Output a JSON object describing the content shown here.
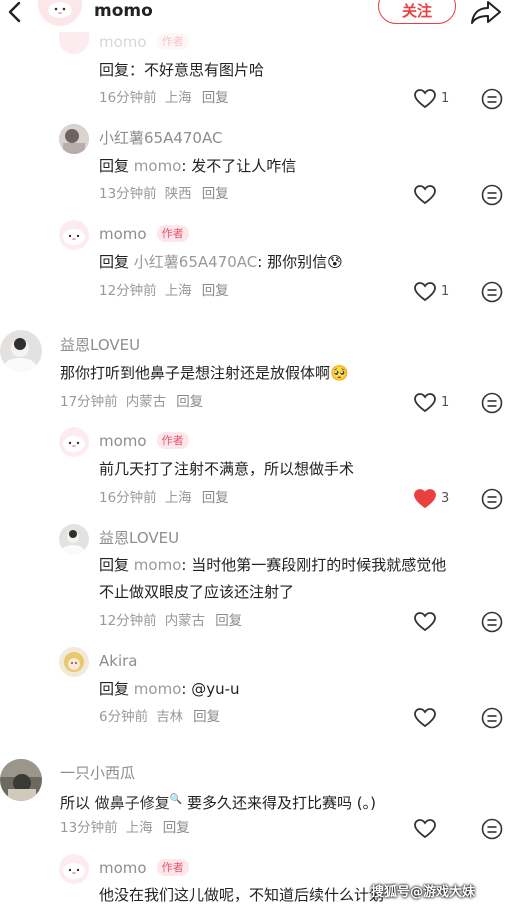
{
  "header": {
    "title": "momo",
    "follow_label": "关注"
  },
  "comments": [
    {
      "user": "momo",
      "author_tag": "作者",
      "prefix": "回复",
      "target": "",
      "text": "：不好意思有图片哈",
      "time": "16分钟前",
      "location": "上海",
      "reply": "回复",
      "likes": "1",
      "liked": false
    },
    {
      "user": "小红薯65A470AC",
      "author_tag": "",
      "prefix": "回复",
      "target": "momo",
      "text": ": 发不了让人咋信",
      "time": "13分钟前",
      "location": "陕西",
      "reply": "回复",
      "likes": "",
      "liked": false
    },
    {
      "user": "momo",
      "author_tag": "作者",
      "prefix": "回复",
      "target": "小红薯65A470AC",
      "text": ": 那你别信",
      "emoji": "😰",
      "time": "12分钟前",
      "location": "上海",
      "reply": "回复",
      "likes": "1",
      "liked": false
    },
    {
      "user": "益恩LOVEU",
      "author_tag": "",
      "text": "那你打听到他鼻子是想注射还是放假体啊",
      "emoji": "🥺",
      "time": "17分钟前",
      "location": "内蒙古",
      "reply": "回复",
      "likes": "1",
      "liked": false
    },
    {
      "user": "momo",
      "author_tag": "作者",
      "text": "前几天打了注射不满意，所以想做手术",
      "time": "16分钟前",
      "location": "上海",
      "reply": "回复",
      "likes": "3",
      "liked": true
    },
    {
      "user": "益恩LOVEU",
      "author_tag": "",
      "prefix": "回复",
      "target": "momo",
      "text": ": 当时他第一赛段刚打的时候我就感觉他",
      "text_line2": "不止做双眼皮了应该还注射了",
      "time": "12分钟前",
      "location": "内蒙古",
      "reply": "回复",
      "likes": "",
      "liked": false
    },
    {
      "user": "Akira",
      "author_tag": "",
      "prefix": "回复",
      "target": "momo",
      "text": ": @yu-u",
      "time": "6分钟前",
      "location": "吉林",
      "reply": "回复",
      "likes": "",
      "liked": false
    },
    {
      "user": "一只小西瓜",
      "author_tag": "",
      "text_a": "所以 ",
      "highlight": "做鼻子修复",
      "text_b": " 要多久还来得及打比赛吗 (。)",
      "time": "13分钟前",
      "location": "上海",
      "reply": "回复",
      "likes": "",
      "liked": false
    },
    {
      "user": "momo",
      "author_tag": "作者",
      "text": "他没在我们这儿做呢，不知道后续什么计划"
    }
  ],
  "watermark": "搜狐号@游戏大妹",
  "colors": {
    "accent": "#e8403f",
    "liked": "#e8403f",
    "meta": "#999999"
  }
}
